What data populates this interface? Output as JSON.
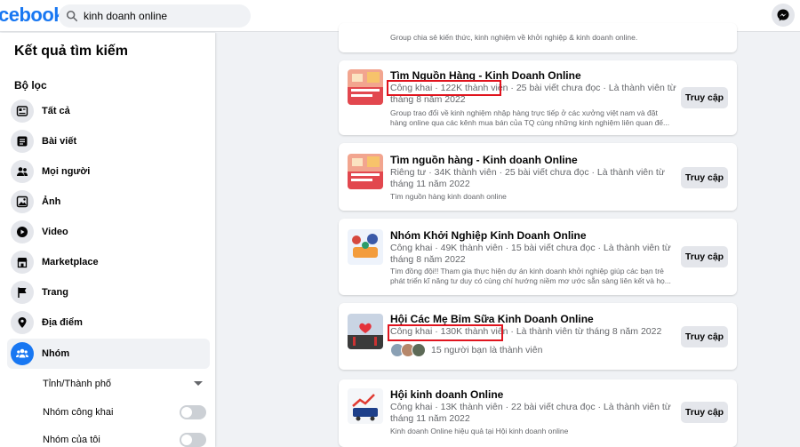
{
  "header": {
    "logo_text": "cebook",
    "search_value": "kinh doanh online",
    "messenger_icon": "messenger-icon"
  },
  "sidebar": {
    "title": "Kết quả tìm kiếm",
    "filter_label": "Bộ lọc",
    "items": [
      {
        "label": "Tất cả",
        "icon": "feed-icon"
      },
      {
        "label": "Bài viết",
        "icon": "post-icon"
      },
      {
        "label": "Mọi người",
        "icon": "people-icon"
      },
      {
        "label": "Ảnh",
        "icon": "photo-icon"
      },
      {
        "label": "Video",
        "icon": "video-icon"
      },
      {
        "label": "Marketplace",
        "icon": "marketplace-icon"
      },
      {
        "label": "Trang",
        "icon": "flag-icon"
      },
      {
        "label": "Địa điểm",
        "icon": "location-icon"
      },
      {
        "label": "Nhóm",
        "icon": "groups-icon"
      }
    ],
    "sub_filters": [
      {
        "label": "Tỉnh/Thành phố"
      },
      {
        "label": "Nhóm công khai"
      },
      {
        "label": "Nhóm của tôi"
      }
    ]
  },
  "results": {
    "top_snippet": "Group chia sẻ kiến thức, kinh nghiệm về khởi nghiệp & kinh doanh online.",
    "cards": [
      {
        "title": "Tìm Nguồn Hàng - Kinh Doanh Online",
        "meta_highlight": "Công khai · 122K thành viên",
        "meta_rest": " · 25 bài viết chưa đọc · Là thành viên từ tháng 8 năm 2022",
        "desc": "Group trao đổi về kinh nghiệm nhập hàng trực tiếp ở các xưởng việt nam và đặt hàng online qua các kênh mua bán của TQ cùng những kinh nghiệm liên quan đế...",
        "button": "Truy cập"
      },
      {
        "title": "Tìm nguồn hàng - Kinh doanh Online",
        "meta": "Riêng tư · 34K thành viên · 25 bài viết chưa đọc · Là thành viên từ tháng 11 năm 2022",
        "desc": "Tìm nguồn hàng kinh doanh online",
        "button": "Truy cập"
      },
      {
        "title": "Nhóm Khởi Nghiệp Kinh Doanh Online",
        "meta": "Công khai · 49K thành viên · 15 bài viết chưa đọc · Là thành viên từ tháng 8 năm 2022",
        "desc": "Tìm đồng đội!! Tham gia thực hiện dự án kinh doanh khởi nghiệp giúp các bạn trẻ phát triển kĩ năng tư duy có cùng chí hướng niềm mơ ước sẵn sàng liên kết và họ...",
        "button": "Truy cập"
      },
      {
        "title": "Hội Các Mẹ Bỉm Sữa Kinh Doanh Online",
        "meta_highlight": "Công khai · 130K thành viên",
        "meta_rest": " · Là thành viên từ tháng 8 năm 2022",
        "friends": "15 người bạn là thành viên",
        "button": "Truy cập"
      },
      {
        "title": "Hội kinh doanh Online",
        "meta": "Công khai · 13K thành viên · 22 bài viết chưa đọc · Là thành viên từ tháng 11 năm 2022",
        "desc": "Kinh doanh Online hiệu quả tại Hội kinh doanh online",
        "button": "Truy cập"
      }
    ]
  },
  "colors": {
    "brand": "#1877f2",
    "highlight_box": "#e0141e"
  }
}
